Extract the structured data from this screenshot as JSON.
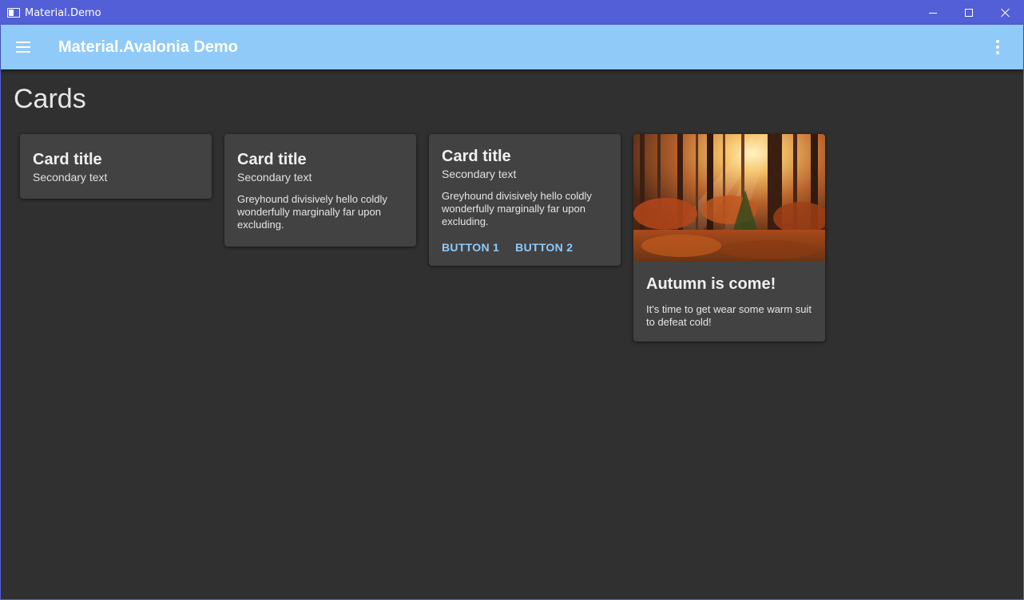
{
  "window": {
    "title": "Material.Demo"
  },
  "appbar": {
    "title": "Material.Avalonia Demo"
  },
  "page": {
    "title": "Cards"
  },
  "cards": [
    {
      "title": "Card title",
      "subtitle": "Secondary text"
    },
    {
      "title": "Card title",
      "subtitle": "Secondary text",
      "body": "Greyhound divisively hello coldly wonderfully marginally far upon excluding."
    },
    {
      "title": "Card title",
      "subtitle": "Secondary text",
      "body": "Greyhound divisively hello coldly wonderfully marginally far upon excluding.",
      "buttons": [
        "BUTTON 1",
        "BUTTON 2"
      ]
    },
    {
      "image": "autumn-forest-image",
      "title": "Autumn is come!",
      "body": "It's time to get wear some warm suit to defeat cold!"
    }
  ],
  "colors": {
    "titlebar": "#525fd6",
    "appbar": "#90caf9",
    "background": "#303030",
    "card": "#424242",
    "accent": "#90caf9"
  }
}
